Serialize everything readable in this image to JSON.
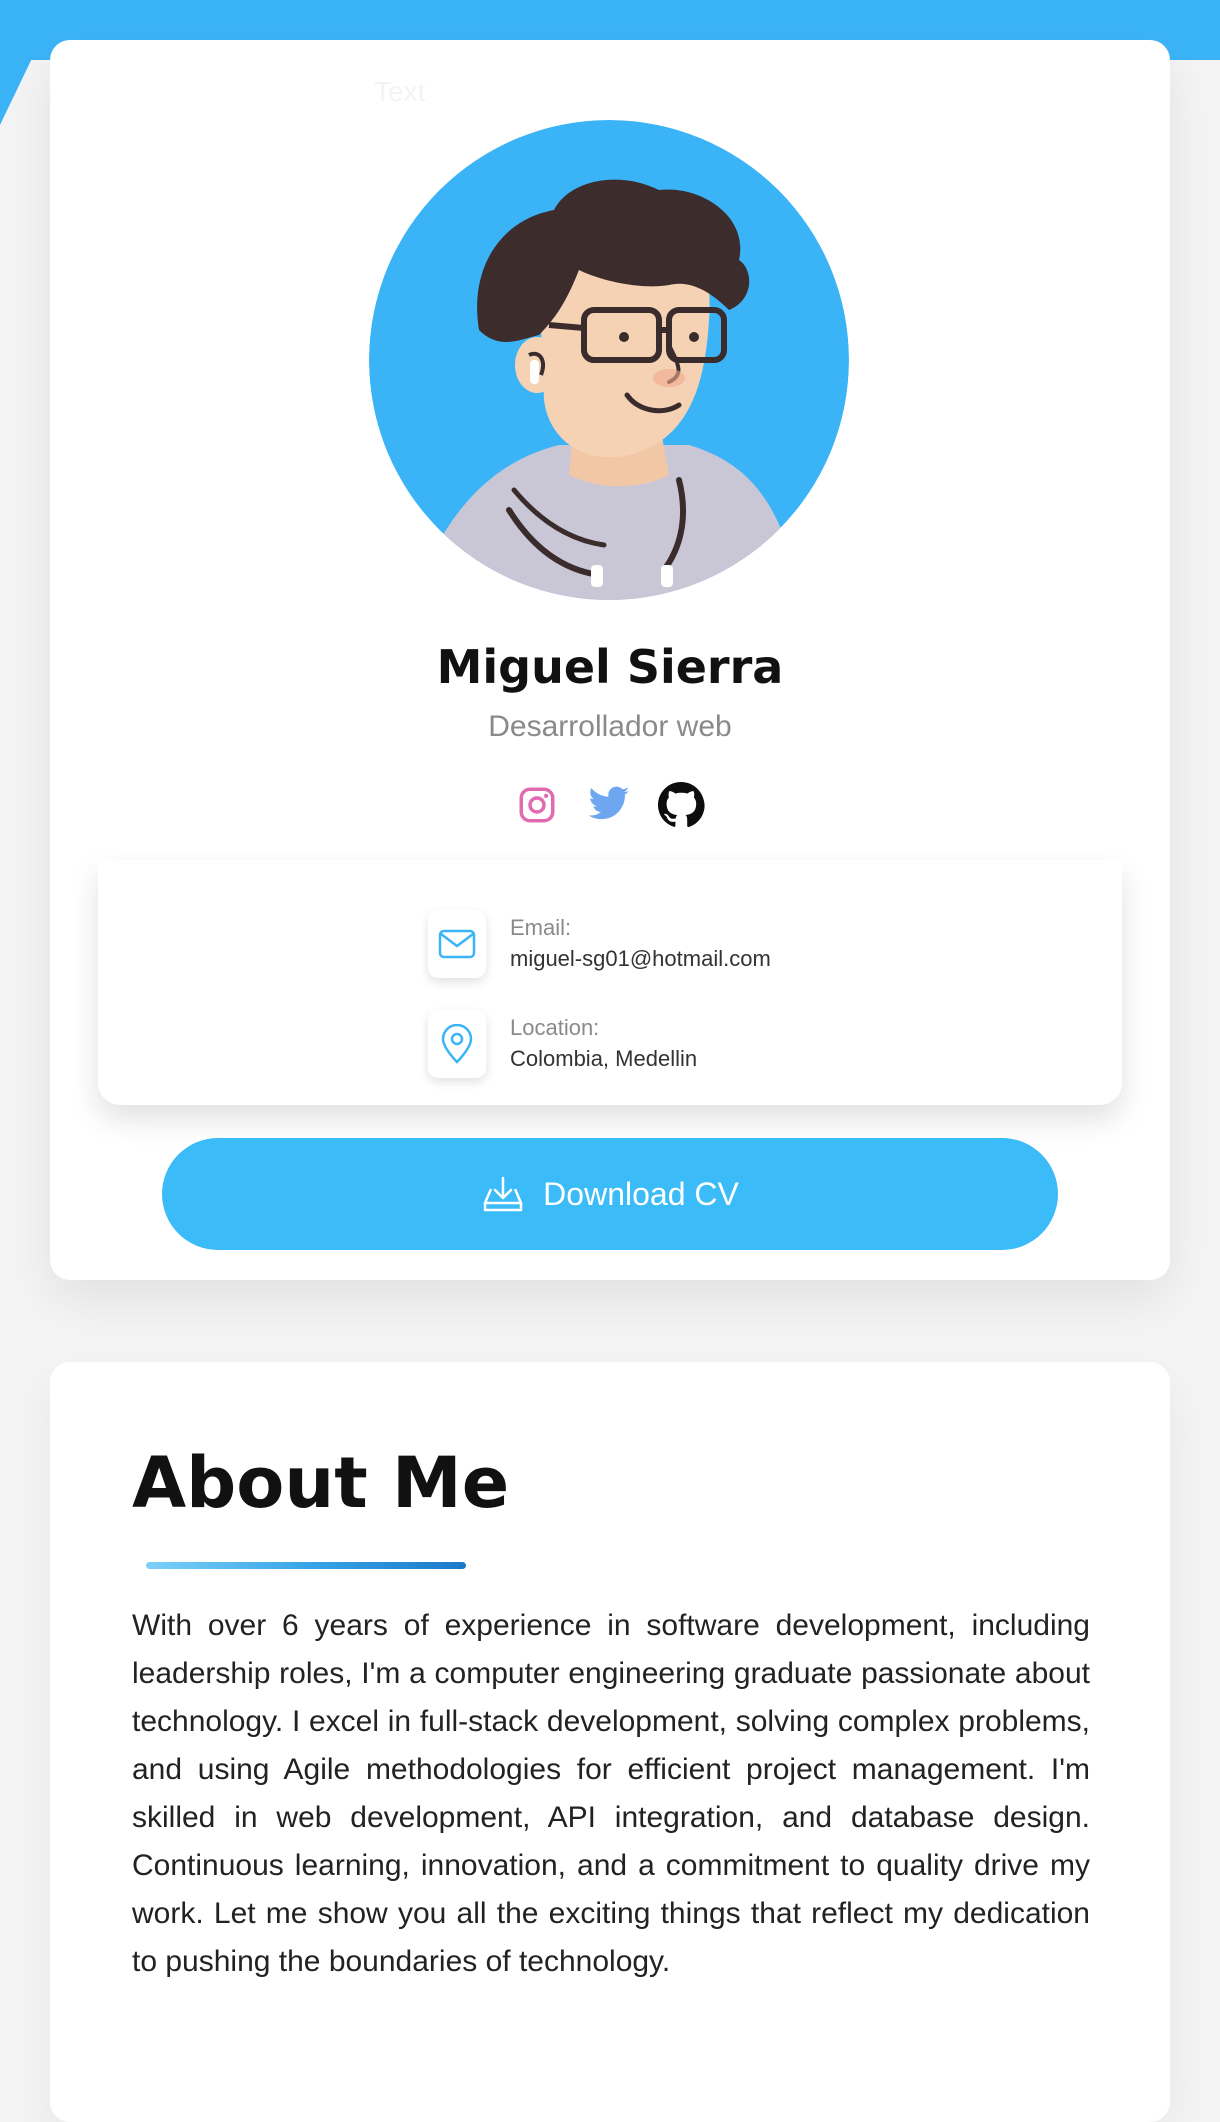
{
  "colors": {
    "accent": "#3bb4f7",
    "button": "#3bbbf8",
    "text": "#111111",
    "muted": "#8a8a8a"
  },
  "profile": {
    "ghost_text": "Text",
    "name": "Miguel Sierra",
    "role": "Desarrollador web",
    "socials": [
      {
        "name": "instagram-icon"
      },
      {
        "name": "twitter-icon"
      },
      {
        "name": "github-icon"
      }
    ],
    "contacts": {
      "email_label": "Email:",
      "email_value": "miguel-sg01@hotmail.com",
      "location_label": "Location:",
      "location_value": "Colombia, Medellin"
    },
    "download_label": "Download CV"
  },
  "about": {
    "title": "About Me",
    "text": "With over 6 years of experience in software development, including leadership roles, I'm a computer engineering graduate passionate about technology. I excel in full-stack development, solving complex problems, and using Agile methodologies for efficient project management. I'm skilled in web development, API integration, and database design. Continuous learning, innovation, and a commitment to quality drive my work. Let me show you all the exciting things that reflect my dedication to pushing the boundaries of technology."
  }
}
